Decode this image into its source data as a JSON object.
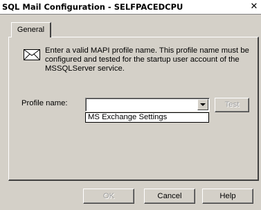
{
  "window": {
    "title": "SQL Mail Configuration - SELFPACEDCPU",
    "close_symbol": "✕"
  },
  "tabs": [
    {
      "label": "General",
      "active": true
    }
  ],
  "info": {
    "icon": "envelope-icon",
    "text": "Enter a valid MAPI profile name.  This profile name must be configured and tested for the startup user account of the MSSQLServer service."
  },
  "profile": {
    "label": "Profile name:",
    "value": "",
    "dropdown_options": [
      "MS Exchange Settings"
    ],
    "test_label": "Test",
    "test_enabled": false
  },
  "buttons": {
    "ok_label": "OK",
    "ok_enabled": false,
    "cancel_label": "Cancel",
    "help_label": "Help"
  },
  "colors": {
    "face": "#d4d0c8",
    "title_bg": "#ffffff"
  }
}
